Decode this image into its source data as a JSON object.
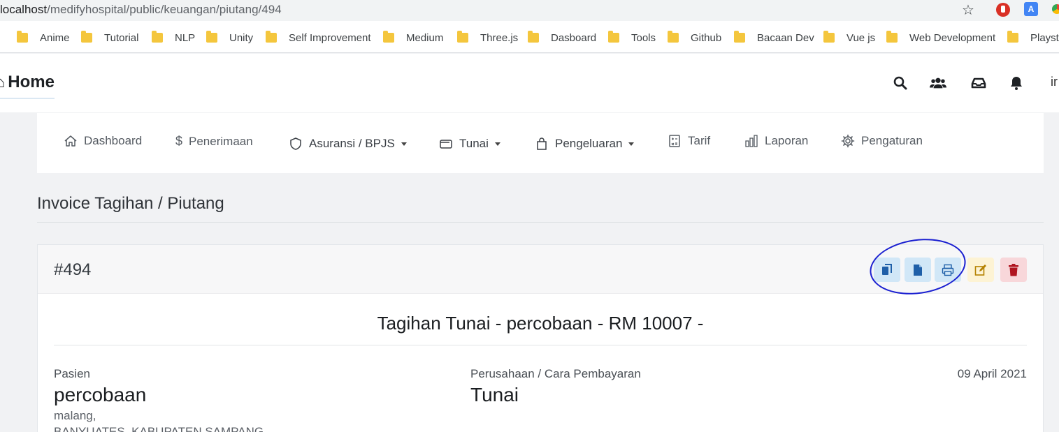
{
  "browser": {
    "url_host": "localhost",
    "url_path": "/medifyhospital/public/keuangan/piutang/494",
    "bookmarks": [
      "Anime",
      "Tutorial",
      "NLP",
      "Unity",
      "Self Improvement",
      "Medium",
      "Three.js",
      "Dasboard",
      "Tools",
      "Github",
      "Bacaan Dev",
      "Vue js",
      "Web Development",
      "Playsto"
    ]
  },
  "navbar": {
    "brand": "Home",
    "icons": [
      "search-icon",
      "users-icon",
      "inbox-icon",
      "bell-icon"
    ],
    "user_initial": "ir"
  },
  "menu": {
    "items": [
      {
        "label": "Dashboard",
        "icon": "home-icon",
        "dropdown": false
      },
      {
        "label": "Penerimaan",
        "icon": "dollar-icon",
        "dropdown": false
      },
      {
        "label": "Asuransi / BPJS",
        "icon": "shield-icon",
        "dropdown": true
      },
      {
        "label": "Tunai",
        "icon": "wallet-icon",
        "dropdown": true
      },
      {
        "label": "Pengeluaran",
        "icon": "bag-icon",
        "dropdown": true
      },
      {
        "label": "Tarif",
        "icon": "calculator-icon",
        "dropdown": false
      },
      {
        "label": "Laporan",
        "icon": "bar-chart-icon",
        "dropdown": false
      },
      {
        "label": "Pengaturan",
        "icon": "gear-icon",
        "dropdown": false
      }
    ]
  },
  "page": {
    "title": "Invoice Tagihan / Piutang"
  },
  "invoice": {
    "number": "#494",
    "actions": [
      "copy-icon",
      "file-icon",
      "print-icon",
      "edit-icon",
      "trash-icon"
    ],
    "title": "Tagihan Tunai - percobaan - RM 10007 -",
    "patient_label": "Pasien",
    "patient_name": "percobaan",
    "patient_city": "malang,",
    "patient_address": "BANYUATES, KABUPATEN SAMPANG",
    "company_label": "Perusahaan / Cara Pembayaran",
    "company_value": "Tunai",
    "date": "09 April 2021"
  },
  "colors": {
    "annotation_circle": "#1a1fd0",
    "primary_btn_bg": "#d1e7f7",
    "primary_btn_icon": "#1f5fa8",
    "warning_btn_bg": "#fdf3d4",
    "warning_btn_icon": "#b58200",
    "danger_btn_bg": "#f8d7da",
    "danger_btn_icon": "#b0141f"
  }
}
